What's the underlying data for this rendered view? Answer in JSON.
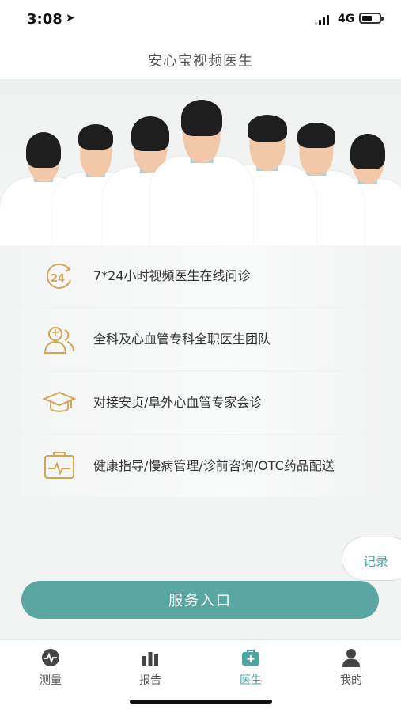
{
  "status_bar": {
    "time": "3:08",
    "network": "4G"
  },
  "header": {
    "title": "安心宝视频医生"
  },
  "features": [
    {
      "icon": "clock-24-icon",
      "text": "7*24小时视频医生在线问诊"
    },
    {
      "icon": "doctor-team-icon",
      "text": "全科及心血管专科全职医生团队"
    },
    {
      "icon": "graduation-cap-icon",
      "text": "对接安贞/阜外心血管专家会诊"
    },
    {
      "icon": "health-record-icon",
      "text": "健康指导/慢病管理/诊前咨询/OTC药品配送"
    }
  ],
  "records_tab": {
    "label": "记录"
  },
  "service_button": {
    "label": "服务入口"
  },
  "tabs": [
    {
      "label": "测量",
      "icon": "heartbeat-icon",
      "active": false
    },
    {
      "label": "报告",
      "icon": "bar-chart-icon",
      "active": false
    },
    {
      "label": "医生",
      "icon": "medical-kit-icon",
      "active": true
    },
    {
      "label": "我的",
      "icon": "user-icon",
      "active": false
    }
  ],
  "colors": {
    "accent": "#5ba6a2",
    "icon_gold": "#d4a553",
    "active_tab": "#4fa4a0"
  }
}
